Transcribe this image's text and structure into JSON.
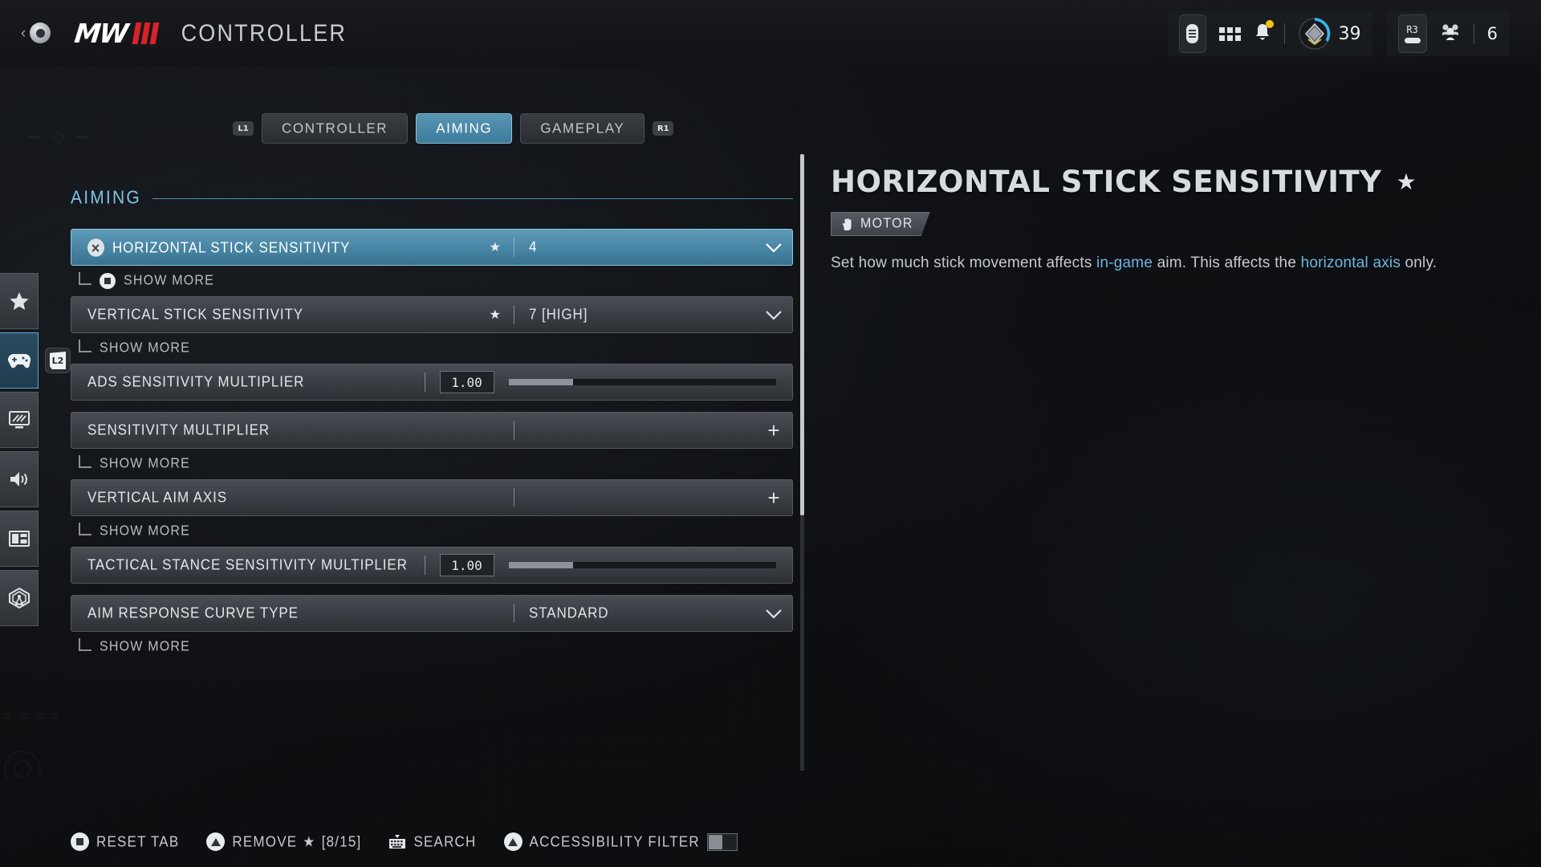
{
  "header": {
    "back_icon": "back-chevron-icon",
    "logo_text": "MW",
    "logo_suffix": "III",
    "title": "CONTROLLER"
  },
  "hud": {
    "touchpad_icon": "touchpad-icon",
    "grid_icon": "grid-menu-icon",
    "bell_icon": "notification-bell-icon",
    "rank_icon": "rank-emblem-icon",
    "rank_value": "39",
    "r3_label": "R3",
    "squad_icon": "squad-icon",
    "squad_value": "6"
  },
  "tabs": {
    "left_bumper": "L1",
    "right_bumper": "R1",
    "items": [
      {
        "label": "CONTROLLER",
        "active": false
      },
      {
        "label": "AIMING",
        "active": true
      },
      {
        "label": "GAMEPLAY",
        "active": false
      }
    ]
  },
  "sidebar": {
    "badge": "L2",
    "items": [
      {
        "name": "favorites",
        "icon": "star-icon",
        "active": false
      },
      {
        "name": "controller",
        "icon": "gamepad-icon",
        "active": true
      },
      {
        "name": "graphics",
        "icon": "monitor-icon",
        "active": false
      },
      {
        "name": "audio",
        "icon": "speaker-icon",
        "active": false
      },
      {
        "name": "interface",
        "icon": "layout-icon",
        "active": false
      },
      {
        "name": "account",
        "icon": "broadcast-icon",
        "active": false
      }
    ]
  },
  "section": {
    "title": "AIMING"
  },
  "settings": [
    {
      "label": "HORIZONTAL STICK SENSITIVITY",
      "value": "4",
      "type": "dropdown",
      "starred": true,
      "selected": true,
      "show_more": "SHOW MORE",
      "show_more_button": true
    },
    {
      "label": "VERTICAL STICK SENSITIVITY",
      "value": "7 [HIGH]",
      "type": "dropdown",
      "starred": true,
      "selected": false,
      "show_more": "SHOW MORE",
      "show_more_button": false
    },
    {
      "label": "ADS SENSITIVITY MULTIPLIER",
      "value": "1.00",
      "type": "slider",
      "fill_percent": 24,
      "starred": false,
      "selected": false,
      "show_more": null
    },
    {
      "label": "SENSITIVITY MULTIPLIER",
      "value": "",
      "type": "expand",
      "starred": false,
      "selected": false,
      "show_more": "SHOW MORE",
      "show_more_button": false
    },
    {
      "label": "VERTICAL AIM AXIS",
      "value": "",
      "type": "expand",
      "starred": false,
      "selected": false,
      "show_more": "SHOW MORE",
      "show_more_button": false
    },
    {
      "label": "TACTICAL STANCE SENSITIVITY MULTIPLIER",
      "value": "1.00",
      "type": "slider",
      "fill_percent": 24,
      "starred": false,
      "selected": false,
      "show_more": null
    },
    {
      "label": "AIM RESPONSE CURVE TYPE",
      "value": "STANDARD",
      "type": "dropdown",
      "starred": false,
      "selected": false,
      "show_more": "SHOW MORE",
      "show_more_button": false
    }
  ],
  "detail": {
    "title": "HORIZONTAL STICK SENSITIVITY",
    "star_icon": "star-icon",
    "tag_icon": "hand-icon",
    "tag_label": "MOTOR",
    "desc_part1": "Set how much stick movement affects ",
    "desc_hl1": "in-game",
    "desc_part2": " aim. This affects the ",
    "desc_hl2": "horizontal axis",
    "desc_part3": " only."
  },
  "bottom_bar": {
    "reset_label": "RESET TAB",
    "remove_label": "REMOVE",
    "remove_count": "[8/15]",
    "search_label": "SEARCH",
    "accessibility_label": "ACCESSIBILITY FILTER"
  },
  "colors": {
    "accent": "#4a87a6",
    "accent_light": "#7fc4e6",
    "brand_red": "#d8232a",
    "notification": "#f2c313"
  }
}
